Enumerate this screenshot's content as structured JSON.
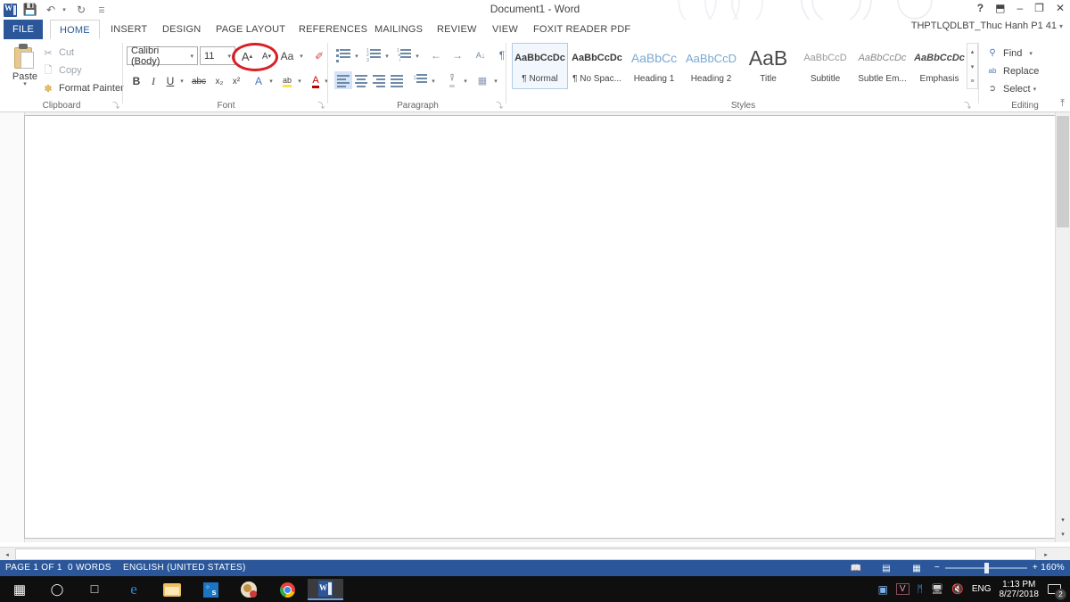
{
  "titlebar": {
    "document_title": "Document1 - Word",
    "quick_access": [
      {
        "name": "word-logo",
        "label": "W"
      },
      {
        "name": "save-icon",
        "label": "💾"
      },
      {
        "name": "undo-icon",
        "label": "↶"
      },
      {
        "name": "undo-dropdown-icon",
        "label": "▾"
      },
      {
        "name": "redo-icon",
        "label": "↻"
      },
      {
        "name": "customize-qat-icon",
        "label": "☰"
      }
    ],
    "window_controls": [
      {
        "name": "help-button",
        "label": "?"
      },
      {
        "name": "ribbon-display-options-button",
        "label": "⬒"
      },
      {
        "name": "minimize-button",
        "label": "–"
      },
      {
        "name": "restore-button",
        "label": "❐"
      },
      {
        "name": "close-button",
        "label": "✕"
      }
    ],
    "account_name": "THPTLQDLBT_Thuc Hanh P1 41",
    "account_caret": "▾"
  },
  "tabs": [
    {
      "label": "FILE",
      "active": false
    },
    {
      "label": "HOME",
      "active": true
    },
    {
      "label": "INSERT",
      "active": false
    },
    {
      "label": "DESIGN",
      "active": false
    },
    {
      "label": "PAGE LAYOUT",
      "active": false
    },
    {
      "label": "REFERENCES",
      "active": false
    },
    {
      "label": "MAILINGS",
      "active": false
    },
    {
      "label": "REVIEW",
      "active": false
    },
    {
      "label": "VIEW",
      "active": false
    },
    {
      "label": "FOXIT READER PDF",
      "active": false
    }
  ],
  "ribbon": {
    "clipboard": {
      "group_label": "Clipboard",
      "paste_label": "Paste",
      "paste_caret": "▾",
      "cut_label": "Cut",
      "copy_label": "Copy",
      "format_painter_label": "Format Painter",
      "dialog_launcher": "⤵"
    },
    "font": {
      "group_label": "Font",
      "font_name": "Calibri (Body)",
      "font_size": "11",
      "grow_font_label": "A",
      "shrink_font_label": "A",
      "change_case_label": "Aa",
      "clear_formatting_label": "✐",
      "bold_label": "B",
      "italic_label": "I",
      "underline_label": "U",
      "strikethrough_label": "abc",
      "subscript_label": "x₂",
      "superscript_label": "x²",
      "text_effects_label": "A",
      "highlight_label": "ab",
      "font_color_label": "A",
      "dialog_launcher": "⤵"
    },
    "paragraph": {
      "group_label": "Paragraph",
      "decrease_indent_label": "←",
      "increase_indent_label": "→",
      "sort_label": "A↓",
      "show_marks_label": "¶",
      "dialog_launcher": "⤵"
    },
    "styles": {
      "group_label": "Styles",
      "items": [
        {
          "sample": "AaBbCcDc",
          "name": "¶ Normal",
          "selected": true
        },
        {
          "sample": "AaBbCcDc",
          "name": "¶ No Spac...",
          "selected": false
        },
        {
          "sample": "AaBbCc",
          "name": "Heading 1",
          "selected": false
        },
        {
          "sample": "AaBbCcD",
          "name": "Heading 2",
          "selected": false
        },
        {
          "sample": "AaB",
          "name": "Title",
          "selected": false
        },
        {
          "sample": "AaBbCcD",
          "name": "Subtitle",
          "selected": false
        },
        {
          "sample": "AaBbCcDc",
          "name": "Subtle Em...",
          "selected": false
        },
        {
          "sample": "AaBbCcDc",
          "name": "Emphasis",
          "selected": false
        }
      ],
      "scroll_up": "▴",
      "scroll_down": "▾",
      "more": "≡",
      "dialog_launcher": "⤵"
    },
    "editing": {
      "group_label": "Editing",
      "find_label": "Find",
      "find_caret": "▾",
      "replace_label": "Replace",
      "select_label": "Select",
      "select_caret": "▾"
    },
    "collapse_ribbon": "⤒"
  },
  "document": {
    "content": ""
  },
  "scrollbars": {
    "v_up": "▴",
    "v_down": "▾",
    "h_left": "◂",
    "h_right": "▸"
  },
  "status": {
    "page": "PAGE 1 OF 1",
    "words": "0 WORDS",
    "language": "ENGLISH (UNITED STATES)",
    "view_read": "📖",
    "view_print": "▤",
    "view_web": "▦",
    "zoom_out": "−",
    "zoom_in": "+",
    "zoom_level": "160%"
  },
  "taskbar": {
    "items": [
      {
        "name": "start-button",
        "label": "⊞"
      },
      {
        "name": "cortana-icon",
        "label": "◯"
      },
      {
        "name": "task-view-icon",
        "label": "❐"
      },
      {
        "name": "edge-icon",
        "label": "e"
      },
      {
        "name": "file-explorer-icon",
        "label": "📁"
      },
      {
        "name": "app-blue-icon",
        "label": "S"
      },
      {
        "name": "media-player-icon",
        "label": "☺"
      },
      {
        "name": "chrome-icon",
        "label": "◉"
      },
      {
        "name": "word-taskbar-icon",
        "label": "W"
      }
    ],
    "tray": [
      {
        "name": "tray-network-share-icon",
        "label": "⌗"
      },
      {
        "name": "tray-v-app-icon",
        "label": "V"
      },
      {
        "name": "bluetooth-icon",
        "label": "ᛗ"
      },
      {
        "name": "network-icon",
        "label": "▣"
      },
      {
        "name": "volume-muted-icon",
        "label": "🔇"
      },
      {
        "name": "language-indicator",
        "label": "ENG"
      }
    ],
    "clock_time": "1:13 PM",
    "clock_date": "8/27/2018",
    "notification_count": "2"
  },
  "colors": {
    "word_blue": "#2b579a",
    "annotation_red": "#d81f26",
    "taskbar": "#0f0f10"
  }
}
